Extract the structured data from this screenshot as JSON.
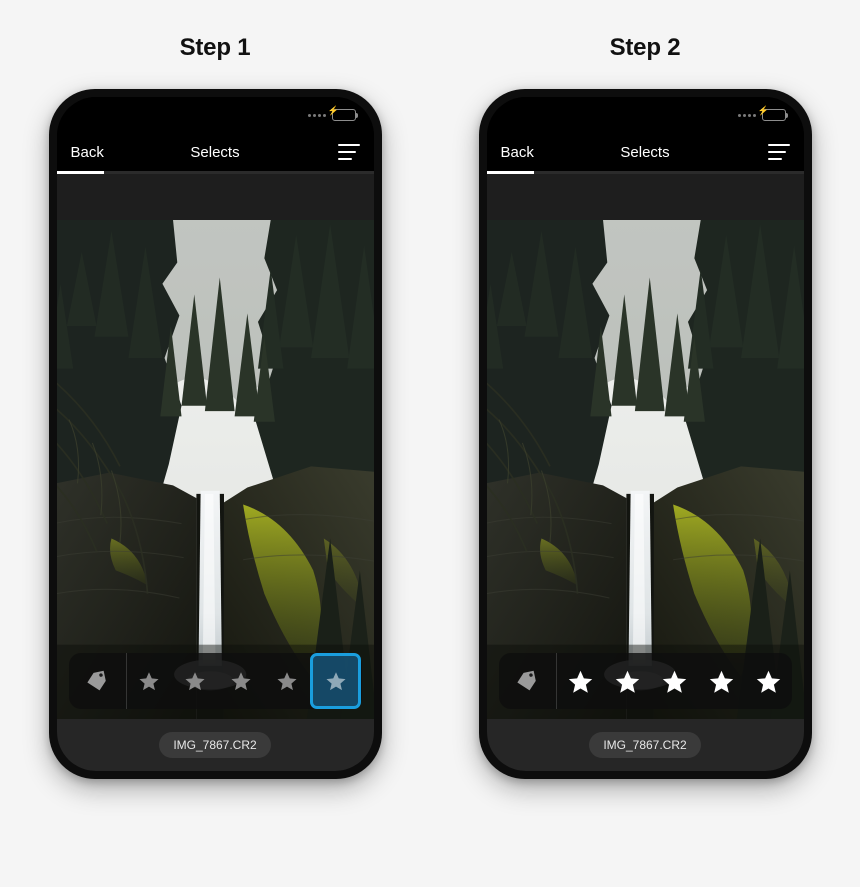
{
  "page": {
    "background_color": "#f5f5f5"
  },
  "steps": [
    {
      "title": "Step 1",
      "status_bar": {
        "signal_icon": "signal-dots-icon",
        "battery_icon": "battery-charging-icon",
        "battery_color": "#33cc44"
      },
      "nav": {
        "back_label": "Back",
        "title": "Selects",
        "menu_icon": "hamburger-menu-icon"
      },
      "progress": {
        "percent": 15
      },
      "photo": {
        "alt": "Tall waterfall falling down a mossy basalt cliff in a conifer forest gorge"
      },
      "rating": {
        "tag_icon": "tag-icon",
        "star_count": 5,
        "filled_stars": 0,
        "selected_index": 5,
        "selection_color": "#1a9ede",
        "star_color": "#8a8a8a",
        "selected_star_color": "#8fa9b8"
      },
      "footer": {
        "filename": "IMG_7867.CR2"
      }
    },
    {
      "title": "Step 2",
      "status_bar": {
        "signal_icon": "signal-dots-icon",
        "battery_icon": "battery-charging-icon",
        "battery_color": "#33cc44"
      },
      "nav": {
        "back_label": "Back",
        "title": "Selects",
        "menu_icon": "hamburger-menu-icon"
      },
      "progress": {
        "percent": 15
      },
      "photo": {
        "alt": "Tall waterfall falling down a mossy basalt cliff in a conifer forest gorge"
      },
      "rating": {
        "tag_icon": "tag-icon",
        "star_count": 5,
        "filled_stars": 5,
        "selected_index": -1,
        "selection_color": "#1a9ede",
        "star_color": "#ffffff",
        "selected_star_color": "#ffffff"
      },
      "footer": {
        "filename": "IMG_7867.CR2"
      }
    }
  ]
}
